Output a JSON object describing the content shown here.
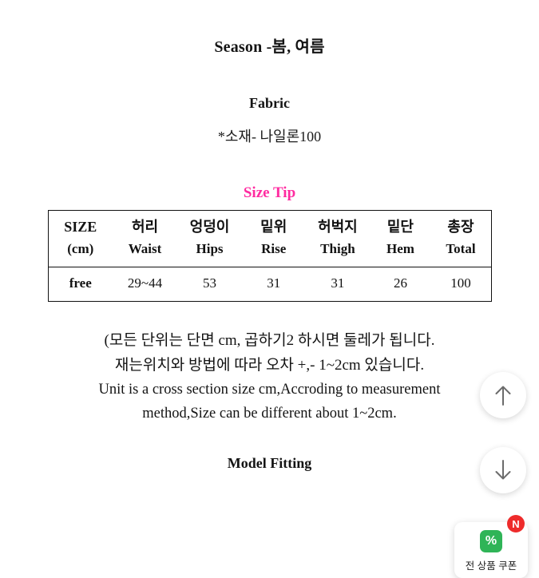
{
  "document": {
    "season_line": "Season -봄, 여름",
    "fabric_title": "Fabric",
    "fabric_value": "*소재- 나일론100",
    "size_tip_title": "Size Tip",
    "size_tip_color": "#ff2ba0",
    "model_fitting": "Model Fitting"
  },
  "size_table": {
    "headers": [
      {
        "ko": "SIZE",
        "en": "(cm)"
      },
      {
        "ko": "허리",
        "en": "Waist"
      },
      {
        "ko": "엉덩이",
        "en": "Hips"
      },
      {
        "ko": "밑위",
        "en": "Rise"
      },
      {
        "ko": "허벅지",
        "en": "Thigh"
      },
      {
        "ko": "밑단",
        "en": "Hem"
      },
      {
        "ko": "총장",
        "en": "Total"
      }
    ],
    "rows": [
      {
        "size": "free",
        "waist": "29~44",
        "hips": "53",
        "rise": "31",
        "thigh": "31",
        "hem": "26",
        "total": "100"
      }
    ]
  },
  "notes": {
    "line1": "(모든 단위는 단면 cm, 곱하기2 하시면 둘레가 됩니다.",
    "line2": "재는위치와 방법에 따라 오차 +,- 1~2cm 있습니다.",
    "line3": "Unit is a cross section size cm,Accroding to measurement",
    "line4": "method,Size can be different about 1~2cm."
  },
  "floating": {
    "scroll_up": "scroll-up-arrow",
    "scroll_down": "scroll-down-arrow",
    "coupon_icon_text": "%",
    "coupon_label": "전 상품 쿠폰",
    "badge_text": "N"
  }
}
